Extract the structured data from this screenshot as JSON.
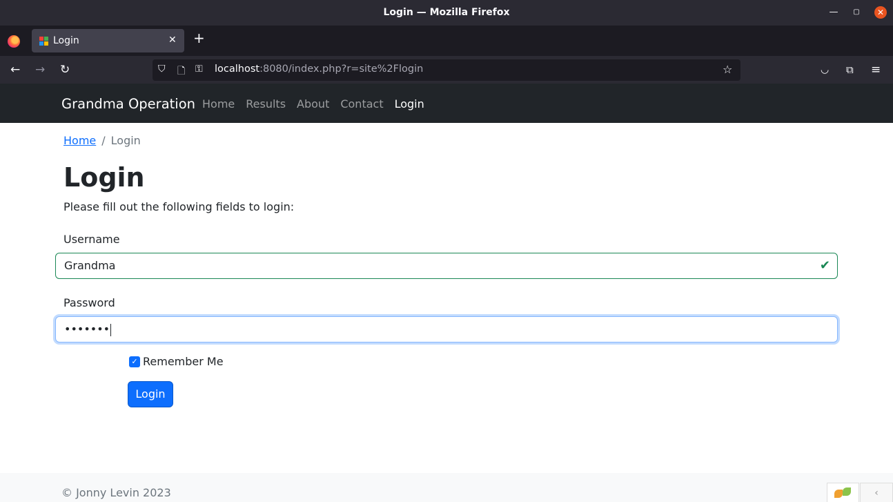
{
  "window": {
    "title": "Login — Mozilla Firefox"
  },
  "browser": {
    "tab_title": "Login",
    "new_tab": "+",
    "url_host": "localhost",
    "url_rest": ":8080/index.php?r=site%2Flogin"
  },
  "site": {
    "brand": "Grandma Operation",
    "nav": [
      "Home",
      "Results",
      "About",
      "Contact",
      "Login"
    ],
    "active_nav": "Login"
  },
  "breadcrumb": {
    "home": "Home",
    "separator": "/",
    "current": "Login"
  },
  "page": {
    "heading": "Login",
    "intro": "Please fill out the following fields to login:"
  },
  "form": {
    "username_label": "Username",
    "username_value": "Grandma",
    "password_label": "Password",
    "password_value": "•••••••",
    "remember_label": "Remember Me",
    "remember_checked": true,
    "submit_label": "Login"
  },
  "footer": {
    "copyright": "© Jonny Levin 2023"
  },
  "colors": {
    "primary": "#0d6efd",
    "valid": "#198754",
    "navbar": "#212529"
  }
}
